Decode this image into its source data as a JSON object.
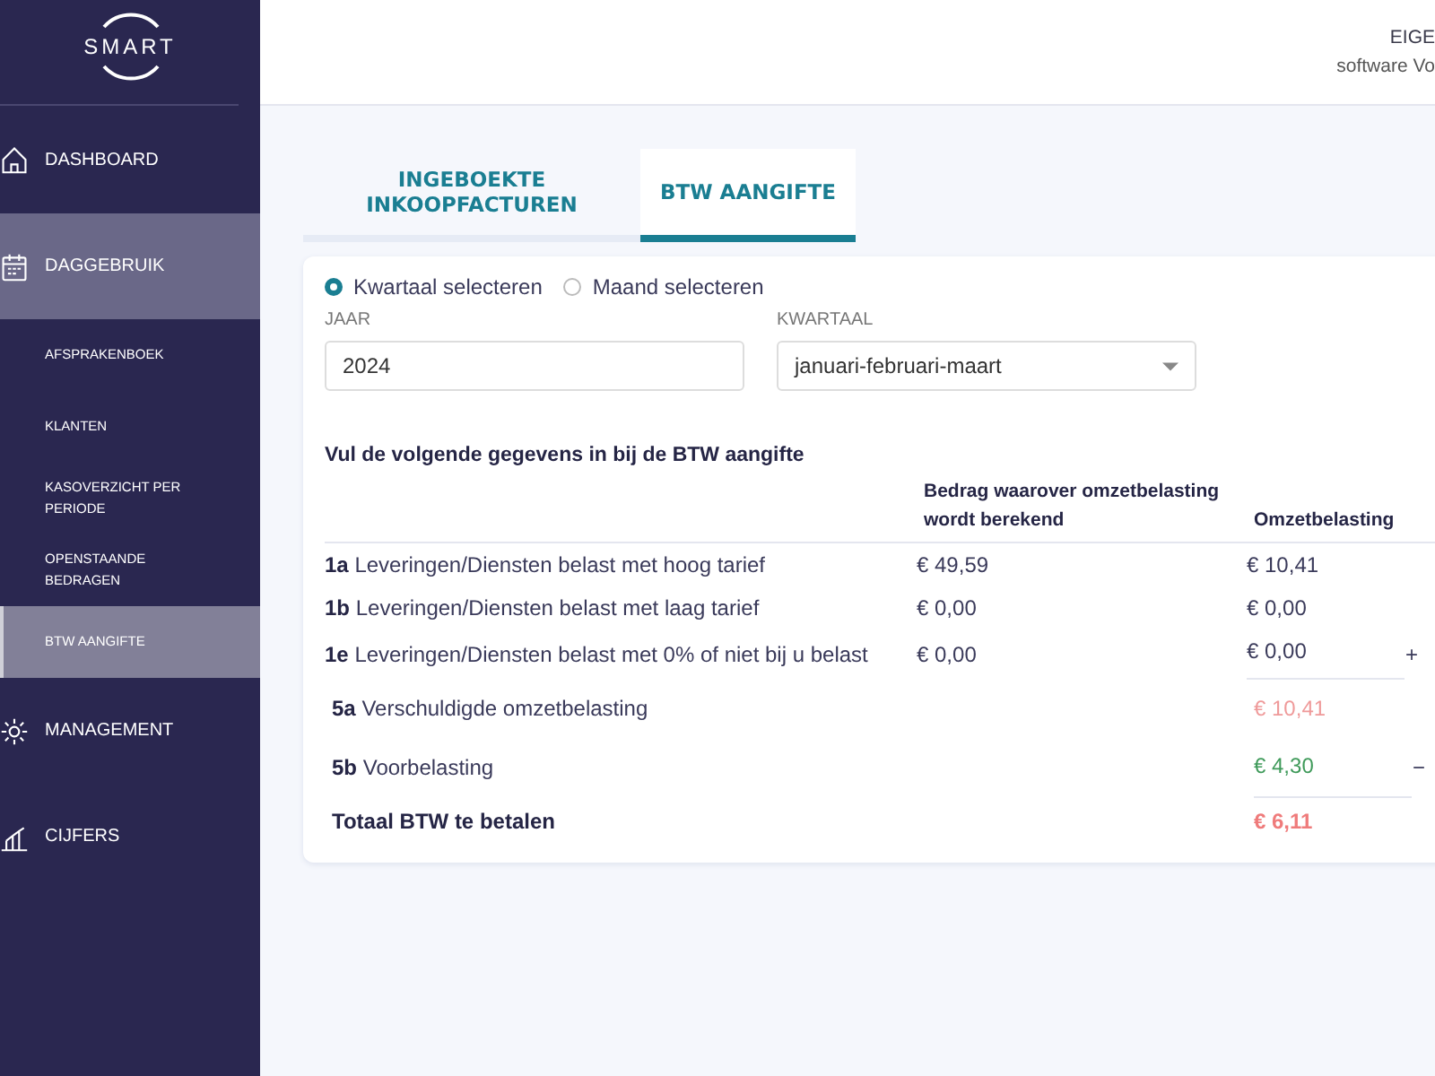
{
  "logo": "SMART",
  "sidebar": {
    "items": [
      {
        "label": "DASHBOARD",
        "kind": "main",
        "selected": false
      },
      {
        "label": "DAGGEBRUIK",
        "kind": "main",
        "selected": true
      },
      {
        "label": "AFSPRAKENBOEK",
        "kind": "sub",
        "selected": false
      },
      {
        "label": "KLANTEN",
        "kind": "sub",
        "selected": false
      },
      {
        "label": "KASOVERZICHT PER PERIODE",
        "kind": "sub",
        "selected": false
      },
      {
        "label": "OPENSTAANDE BEDRAGEN",
        "kind": "sub",
        "selected": false
      },
      {
        "label": "BTW AANGIFTE",
        "kind": "sub",
        "selected": true
      },
      {
        "label": "MANAGEMENT",
        "kind": "main",
        "selected": false
      },
      {
        "label": "CIJFERS",
        "kind": "main",
        "selected": false
      }
    ]
  },
  "header": {
    "line_1": "EIGE",
    "line_2": "software Vo"
  },
  "tabs": [
    {
      "label": "INGEBOEKTE INKOOPFACTUREN",
      "selected": false
    },
    {
      "label": "BTW AANGIFTE",
      "selected": true
    }
  ],
  "period": {
    "options": [
      {
        "label": "Kwartaal selecteren",
        "selected": true
      },
      {
        "label": "Maand selecteren",
        "selected": false
      }
    ],
    "year": {
      "label": "JAAR",
      "value": "2024"
    },
    "quarter": {
      "label": "KWARTAAL",
      "value": "januari-februari-maart"
    }
  },
  "table": {
    "title": "Vul de volgende gegevens in bij de BTW aangifte",
    "columns": [
      "Bedrag waarover omzetbelasting wordt berekend",
      "Omzetbelasting"
    ],
    "rows": [
      {
        "code": "1a",
        "label": "Leveringen/Diensten belast met hoog tarief",
        "amount": "€ 49,59",
        "tax": "€ 10,41",
        "kind": "plain"
      },
      {
        "code": "1b",
        "label": "Leveringen/Diensten belast met laag tarief",
        "amount": "€ 0,00",
        "tax": "€ 0,00",
        "kind": "plain"
      },
      {
        "code": "1e",
        "label": "Leveringen/Diensten belast met 0% of niet bij u belast",
        "amount": "€ 0,00",
        "tax": "€ 0,00",
        "sign": "+",
        "kind": "plain"
      },
      {
        "code": "5a",
        "label": "Verschuldigde omzetbelasting",
        "tax": "€ 10,41",
        "kind": "due"
      },
      {
        "code": "5b",
        "label": "Voorbelasting",
        "tax": "€ 4,30",
        "sign": "−",
        "kind": "credit"
      },
      {
        "label": "Totaal BTW te betalen",
        "tax": "€ 6,11",
        "kind": "total"
      }
    ]
  }
}
